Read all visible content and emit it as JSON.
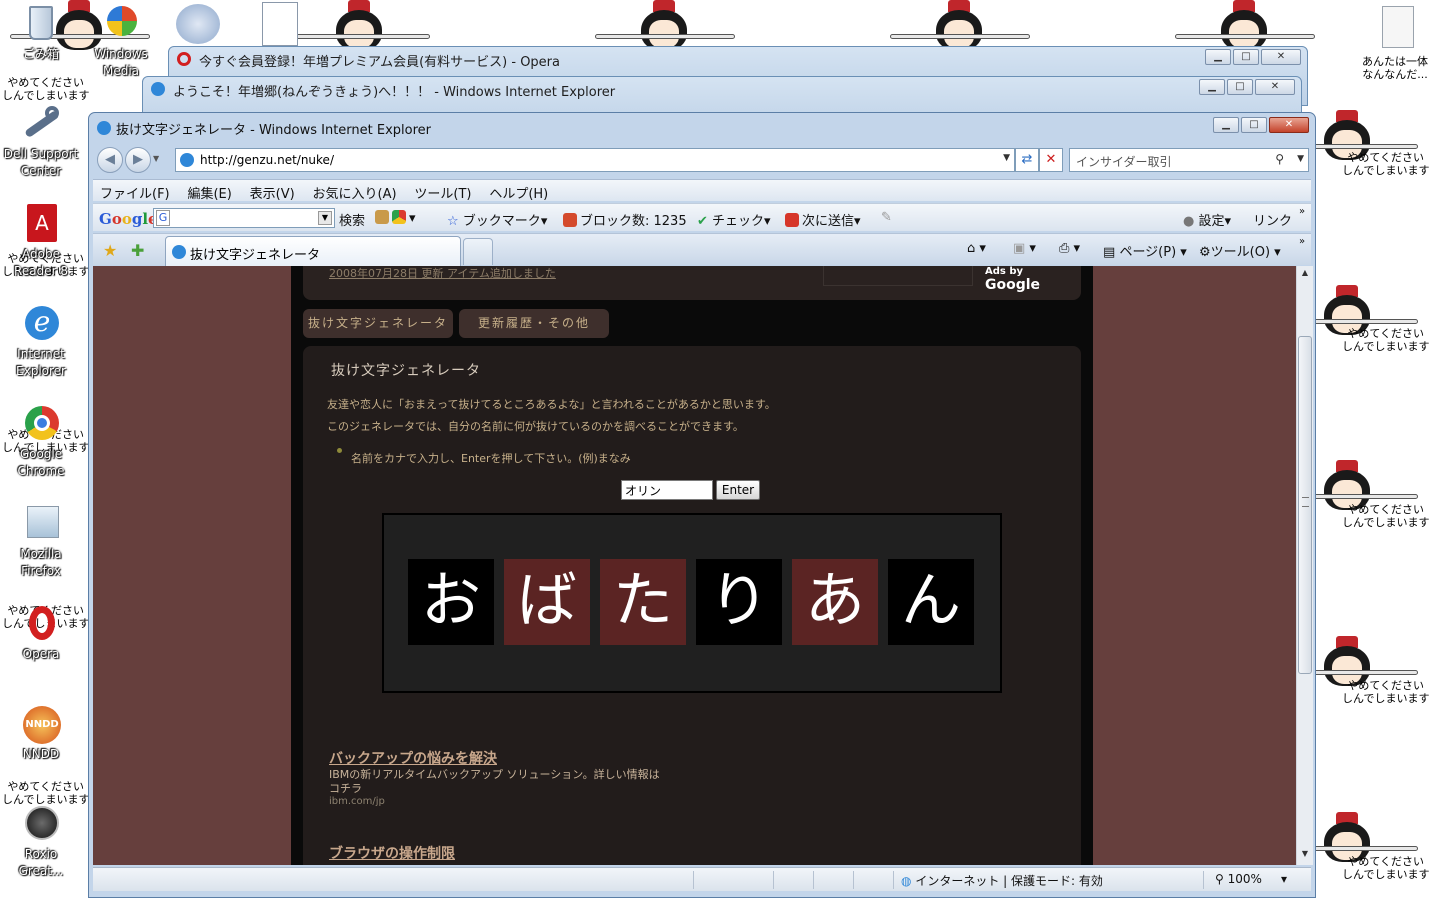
{
  "desktop": {
    "icons": [
      {
        "label": "ごみ箱",
        "name": "recycle-bin"
      },
      {
        "label": "Windows\nMedia",
        "name": "windows-media"
      },
      {
        "label": "Dell Support\nCenter",
        "name": "dell-support-center"
      },
      {
        "label": "Adobe\nReader 8",
        "name": "adobe-reader"
      },
      {
        "label": "Internet\nExplorer",
        "name": "internet-explorer"
      },
      {
        "label": "Google\nChrome",
        "name": "google-chrome"
      },
      {
        "label": "Mozilla\nFirefox",
        "name": "mozilla-firefox"
      },
      {
        "label": "Opera",
        "name": "opera"
      },
      {
        "label": "NNDD",
        "name": "nndd"
      },
      {
        "label": "Roxio\nGreat...",
        "name": "roxio"
      }
    ],
    "wallpaper_text": "やめてください\nしんでしまいます",
    "wallpaper_text_alt": "あんたは一体\nなんなんだ..."
  },
  "bg_windows": {
    "opera_title": "今すぐ会員登録！年増プレミアム会員(有料サービス) - Opera",
    "ie2_title": "ようこそ！年増郷(ねんぞうきょう)へ！！！ - Windows Internet Explorer"
  },
  "ie": {
    "title": "抜け文字ジェネレータ - Windows Internet Explorer",
    "url": "http://genzu.net/nuke/",
    "search_placeholder": "インサイダー取引",
    "menu": [
      "ファイル(F)",
      "編集(E)",
      "表示(V)",
      "お気に入り(A)",
      "ツール(T)",
      "ヘルプ(H)"
    ],
    "google_toolbar": {
      "search": "検索",
      "bookmark": "ブックマーク",
      "block": "ブロック数: 1235",
      "check": "チェック",
      "send": "次に送信",
      "settings": "設定",
      "link": "リンク"
    },
    "tab_label": "抜け文字ジェネレータ",
    "page_menu": "ページ(P)",
    "tools_menu": "ツール(O)",
    "status": {
      "zone": "インターネット | 保護モード: 有効",
      "zoom": "100%"
    }
  },
  "page": {
    "ads_by": "Ads by",
    "ads_google": "Google",
    "header_cut_text": "2008年07月28日 更新 アイテム追加しました",
    "tabs": [
      "抜け文字ジェネレータ",
      "更新履歴・その他"
    ],
    "heading": "抜け文字ジェネレータ",
    "intro1": "友達や恋人に「おまえって抜けてるところあるよな」と言われることがあるかと思います。",
    "intro2": "このジェネレータでは、自分の名前に何が抜けているのかを調べることができます。",
    "instruction": "名前をカナで入力し、Enterを押して下さい。(例)まなみ",
    "input_value": "オリン",
    "enter_label": "Enter",
    "result_chars": [
      {
        "char": "お",
        "highlight": false
      },
      {
        "char": "ば",
        "highlight": true
      },
      {
        "char": "た",
        "highlight": true
      },
      {
        "char": "り",
        "highlight": false
      },
      {
        "char": "あ",
        "highlight": true
      },
      {
        "char": "ん",
        "highlight": false
      }
    ],
    "ads": [
      {
        "title": "バックアップの悩みを解決",
        "text": "IBMの新リアルタイムバックアップ ソリューション。詳しい情報はコチラ",
        "url": "ibm.com/jp"
      },
      {
        "title": "ブラウザの操作制限",
        "text": "",
        "url": ""
      }
    ]
  },
  "colors": {
    "page_bg": "#663f3d",
    "column_bg": "#0a0a0a",
    "panel_bg": "#221c1b",
    "char_dark": "#000000",
    "char_red": "#5b2423",
    "text_gold": "#c7b08a"
  }
}
